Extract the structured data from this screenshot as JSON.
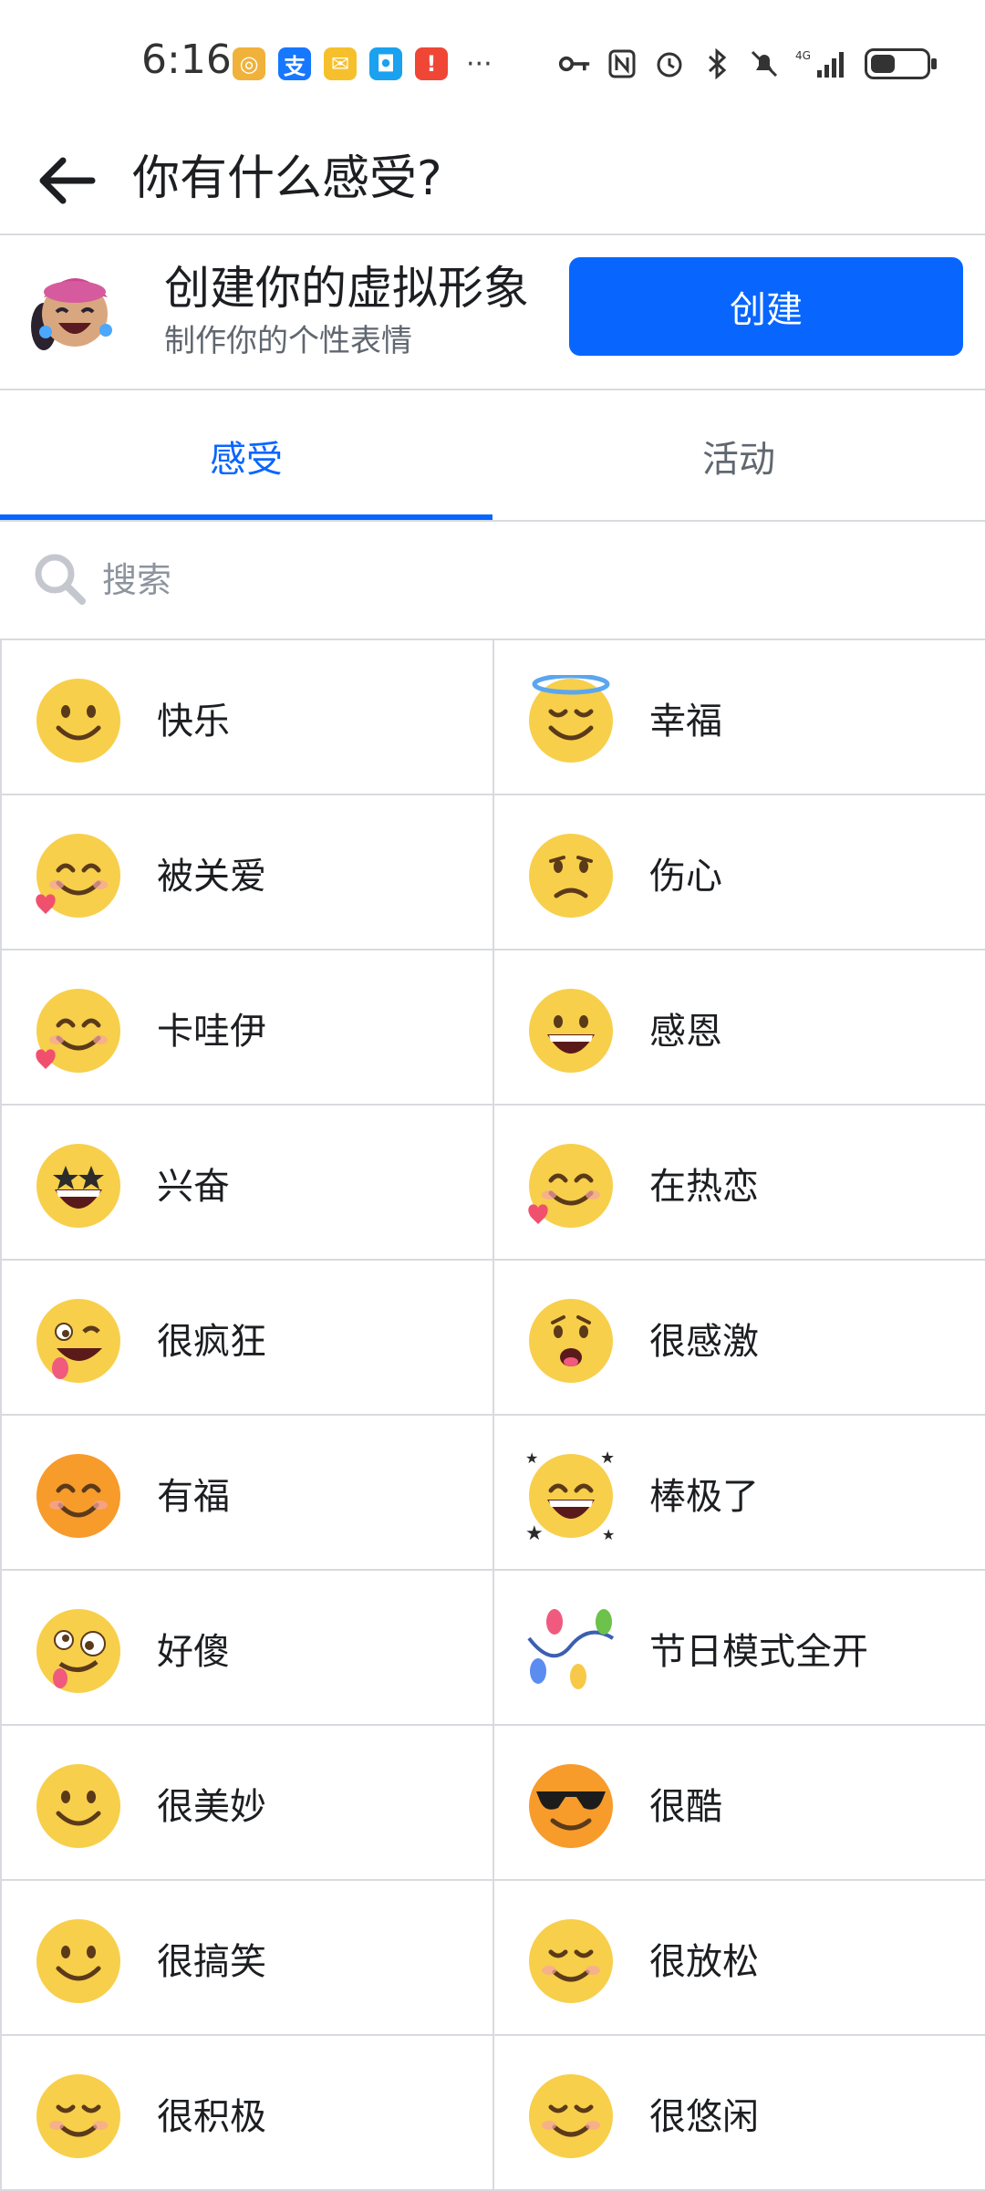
{
  "status_bar": {
    "time": "6:16",
    "more": "···",
    "signal": "4G"
  },
  "header": {
    "title": "你有什么感受?"
  },
  "promo": {
    "title": "创建你的虚拟形象",
    "subtitle": "制作你的个性表情",
    "button": "创建"
  },
  "tabs": [
    {
      "label": "感受",
      "active": true
    },
    {
      "label": "活动",
      "active": false
    }
  ],
  "search": {
    "placeholder": "搜索"
  },
  "feelings": [
    {
      "label": "快乐",
      "icon": "slightly-smiling-face-icon"
    },
    {
      "label": "幸福",
      "icon": "halo-face-icon"
    },
    {
      "label": "被关爱",
      "icon": "smiling-face-with-heart-icon"
    },
    {
      "label": "伤心",
      "icon": "sad-face-icon"
    },
    {
      "label": "卡哇伊",
      "icon": "smiling-face-with-heart-icon"
    },
    {
      "label": "感恩",
      "icon": "grinning-face-icon"
    },
    {
      "label": "兴奋",
      "icon": "star-struck-face-icon"
    },
    {
      "label": "在热恋",
      "icon": "smiling-face-with-heart-icon"
    },
    {
      "label": "很疯狂",
      "icon": "winking-tongue-face-icon"
    },
    {
      "label": "很感激",
      "icon": "grateful-face-icon"
    },
    {
      "label": "有福",
      "icon": "blushing-face-icon"
    },
    {
      "label": "棒极了",
      "icon": "stars-grin-face-icon"
    },
    {
      "label": "好傻",
      "icon": "zany-face-icon"
    },
    {
      "label": "节日模式全开",
      "icon": "string-lights-icon"
    },
    {
      "label": "很美妙",
      "icon": "slightly-smiling-face-icon"
    },
    {
      "label": "很酷",
      "icon": "sunglasses-face-icon"
    },
    {
      "label": "很搞笑",
      "icon": "slightly-smiling-face-icon"
    },
    {
      "label": "很放松",
      "icon": "relieved-face-icon"
    },
    {
      "label": "很积极",
      "icon": "relieved-face-icon"
    },
    {
      "label": "很悠闲",
      "icon": "relieved-face-icon"
    }
  ]
}
